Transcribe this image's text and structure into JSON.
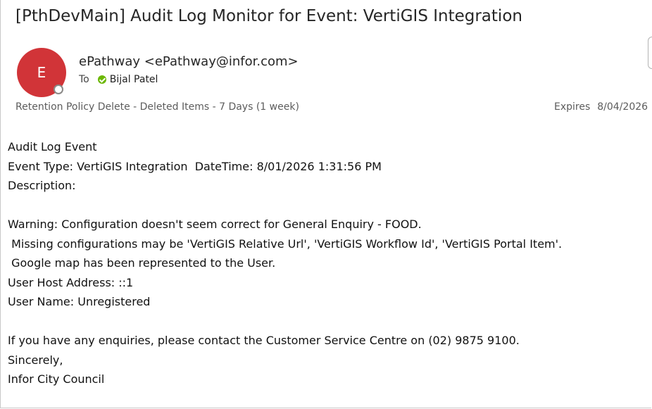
{
  "email": {
    "subject": "[PthDevMain] Audit Log Monitor for Event:  VertiGIS Integration",
    "avatar_initial": "E",
    "sender": "ePathway <ePathway@infor.com>",
    "to_label": "To",
    "recipient": "Bijal Patel",
    "retention_label": "Retention Policy",
    "retention_value": "Delete - Deleted Items - 7 Days (1 week)",
    "expires_label": "Expires",
    "expires_value": "8/04/2026",
    "colors": {
      "avatar": "#d13438",
      "presence_ok": "#6bb700"
    }
  },
  "body": {
    "line1": "Audit Log Event",
    "line2": "Event Type: VertiGIS Integration  DateTime: 8/01/2026 1:31:56 PM",
    "line3": "Description:",
    "line4": "Warning: Configuration doesn't seem correct for General Enquiry - FOOD.",
    "line5": " Missing configurations may be 'VertiGIS Relative Url', 'VertiGIS Workflow Id', 'VertiGIS Portal Item'.",
    "line6": " Google map has been represented to the User.",
    "line7": "User Host Address: ::1",
    "line8": "User Name: Unregistered",
    "line9": "If you have any enquiries, please contact the Customer Service Centre on (02) 9875 9100.",
    "line10": "Sincerely,",
    "line11": "Infor City Council"
  }
}
